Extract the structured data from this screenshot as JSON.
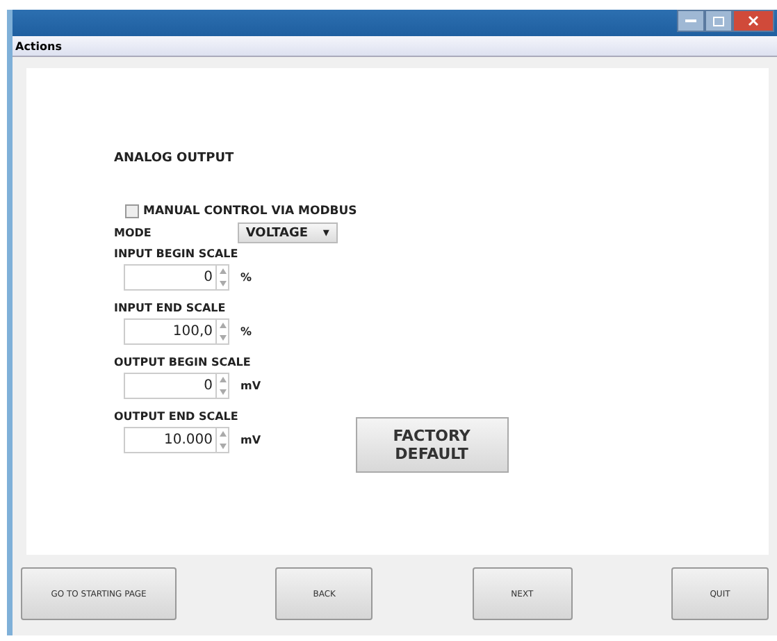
{
  "menu": [
    "Actions"
  ],
  "section_title": "ANALOG OUTPUT",
  "manual_control": {
    "label": "MANUAL CONTROL VIA MODBUS",
    "checked": false
  },
  "mode": {
    "label": "MODE",
    "value": "VOLTAGE",
    "arrow": "▾"
  },
  "fields": [
    {
      "label": "INPUT BEGIN SCALE",
      "value": "0",
      "unit": "%"
    },
    {
      "label": "INPUT END SCALE",
      "value": "100,0",
      "unit": "%"
    },
    {
      "label": "OUTPUT BEGIN SCALE",
      "value": "0",
      "unit": "mV"
    },
    {
      "label": "OUTPUT END SCALE",
      "value": "10.000",
      "unit": "mV"
    }
  ],
  "factory_button": "FACTORY DEFAULT",
  "buttons": [
    "GO TO STARTING PAGE",
    "BACK",
    "NEXT",
    "QUIT"
  ]
}
